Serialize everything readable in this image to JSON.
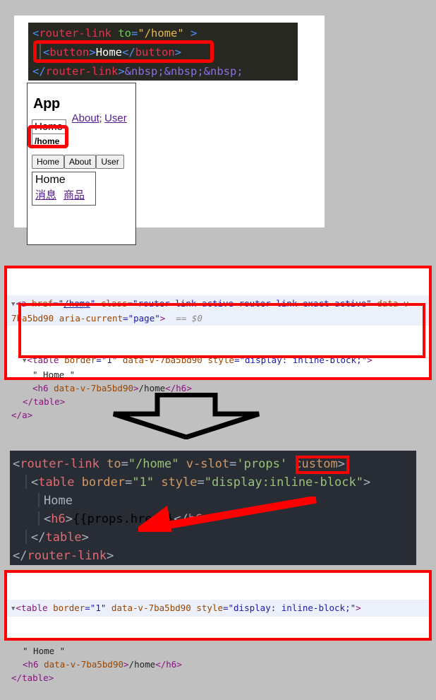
{
  "page": {
    "background_color": "#c0c0c0",
    "white_area_color": "#ffffff",
    "highlight_color": "#ff0000"
  },
  "code_top": {
    "theme_background": "#272822",
    "lines": [
      {
        "tokens": [
          {
            "t": "<",
            "c": "punct"
          },
          {
            "t": "router-link",
            "c": "tag"
          },
          {
            "t": " ",
            "c": "text"
          },
          {
            "t": "to",
            "c": "attr"
          },
          {
            "t": "=",
            "c": "punct"
          },
          {
            "t": "\"/home\"",
            "c": "val"
          },
          {
            "t": " ",
            "c": "text"
          },
          {
            "t": ">",
            "c": "punct"
          }
        ]
      },
      {
        "indent": true,
        "tokens": [
          {
            "t": "<",
            "c": "punct"
          },
          {
            "t": "button",
            "c": "tag"
          },
          {
            "t": ">",
            "c": "punct"
          },
          {
            "t": "Home",
            "c": "text"
          },
          {
            "t": "</",
            "c": "punct"
          },
          {
            "t": "button",
            "c": "tag"
          },
          {
            "t": ">",
            "c": "punct"
          }
        ]
      },
      {
        "tokens": [
          {
            "t": "</",
            "c": "punct"
          },
          {
            "t": "router-link",
            "c": "tag"
          },
          {
            "t": ">",
            "c": "punct"
          },
          {
            "t": "&nbsp;&nbsp;&nbsp;",
            "c": "entity"
          }
        ]
      }
    ],
    "highlighted_line": "<button>Home</button>"
  },
  "app_preview": {
    "title": "App",
    "home_cell_label": "Home",
    "home_path": "/home",
    "nav_links": [
      {
        "label": "About",
        "color": "#551a8b"
      },
      {
        "label": "User",
        "color": "#551a8b"
      }
    ],
    "nav_separator": ";",
    "buttons": [
      "Home",
      "About",
      "User"
    ],
    "content_title": "Home",
    "content_links": [
      "消息",
      "商品"
    ]
  },
  "devtools_top": {
    "selected_line": {
      "triangle": "▼",
      "tokens": [
        {
          "t": "<",
          "c": "ang"
        },
        {
          "t": "a",
          "c": "name"
        },
        {
          "t": " ",
          "c": "txt"
        },
        {
          "t": "href",
          "c": "attr"
        },
        {
          "t": "=\"",
          "c": "aval"
        },
        {
          "t": "/home",
          "c": "link"
        },
        {
          "t": "\"",
          "c": "aval"
        },
        {
          "t": " ",
          "c": "txt"
        },
        {
          "t": "class",
          "c": "attr"
        },
        {
          "t": "=\"router-link-active router-link-exact-active\"",
          "c": "aval"
        },
        {
          "t": " ",
          "c": "txt"
        },
        {
          "t": "data-v-7ba5bd90",
          "c": "attr"
        },
        {
          "t": " ",
          "c": "txt"
        },
        {
          "t": "aria-current",
          "c": "attr"
        },
        {
          "t": "=\"page\"",
          "c": "aval"
        },
        {
          "t": ">",
          "c": "ang"
        },
        {
          "t": "  == $0",
          "c": "gray"
        }
      ]
    },
    "child_lines": [
      {
        "indent": 1,
        "triangle": "▼",
        "tokens": [
          {
            "t": "<",
            "c": "ang"
          },
          {
            "t": "table",
            "c": "name"
          },
          {
            "t": " ",
            "c": "txt"
          },
          {
            "t": "border",
            "c": "attr"
          },
          {
            "t": "=\"1\"",
            "c": "aval"
          },
          {
            "t": " ",
            "c": "txt"
          },
          {
            "t": "data-v-7ba5bd90",
            "c": "attr"
          },
          {
            "t": " ",
            "c": "txt"
          },
          {
            "t": "style",
            "c": "attr"
          },
          {
            "t": "=\"display: inline-block;\"",
            "c": "aval"
          },
          {
            "t": ">",
            "c": "ang"
          }
        ]
      },
      {
        "indent": 2,
        "tokens": [
          {
            "t": "\" Home \"",
            "c": "txt"
          }
        ]
      },
      {
        "indent": 2,
        "tokens": [
          {
            "t": "<",
            "c": "ang"
          },
          {
            "t": "h6",
            "c": "name"
          },
          {
            "t": " ",
            "c": "txt"
          },
          {
            "t": "data-v-7ba5bd90",
            "c": "attr"
          },
          {
            "t": ">",
            "c": "ang"
          },
          {
            "t": "/home",
            "c": "txt"
          },
          {
            "t": "</",
            "c": "ang"
          },
          {
            "t": "h6",
            "c": "name"
          },
          {
            "t": ">",
            "c": "ang"
          }
        ]
      },
      {
        "indent": 1,
        "tokens": [
          {
            "t": "</",
            "c": "ang"
          },
          {
            "t": "table",
            "c": "name"
          },
          {
            "t": ">",
            "c": "ang"
          }
        ]
      },
      {
        "indent": 0,
        "tokens": [
          {
            "t": "</",
            "c": "ang"
          },
          {
            "t": "a",
            "c": "name"
          },
          {
            "t": ">",
            "c": "ang"
          }
        ]
      }
    ]
  },
  "code_bottom": {
    "theme_background": "#282c34",
    "lines": [
      {
        "indent": 0,
        "tokens": [
          {
            "t": "<",
            "c": "punct"
          },
          {
            "t": "router-link",
            "c": "tag"
          },
          {
            "t": " ",
            "c": "text"
          },
          {
            "t": "to",
            "c": "attr"
          },
          {
            "t": "=",
            "c": "punct"
          },
          {
            "t": "\"/home\"",
            "c": "val"
          },
          {
            "t": " ",
            "c": "text"
          },
          {
            "t": "v-slot",
            "c": "attr"
          },
          {
            "t": "=",
            "c": "punct"
          },
          {
            "t": "'props'",
            "c": "val"
          },
          {
            "t": " ",
            "c": "text"
          },
          {
            "t": "custom",
            "c": "attr"
          },
          {
            "t": ">",
            "c": "punct"
          }
        ]
      },
      {
        "indent": 1,
        "tokens": [
          {
            "t": "<",
            "c": "punct"
          },
          {
            "t": "table",
            "c": "tag"
          },
          {
            "t": " ",
            "c": "text"
          },
          {
            "t": "border",
            "c": "attr"
          },
          {
            "t": "=",
            "c": "punct"
          },
          {
            "t": "\"1\"",
            "c": "val"
          },
          {
            "t": " ",
            "c": "text"
          },
          {
            "t": "style",
            "c": "attr"
          },
          {
            "t": "=",
            "c": "punct"
          },
          {
            "t": "\"display:inline-block\"",
            "c": "val"
          },
          {
            "t": ">",
            "c": "punct"
          }
        ]
      },
      {
        "indent": 2,
        "tokens": [
          {
            "t": "Home",
            "c": "text"
          }
        ]
      },
      {
        "indent": 2,
        "tokens": [
          {
            "t": "<",
            "c": "punct"
          },
          {
            "t": "h6",
            "c": "tag"
          },
          {
            "t": ">",
            "c": "punct"
          },
          {
            "t": "{{props.href}}",
            "c": "mustache"
          },
          {
            "t": "</",
            "c": "punct"
          },
          {
            "t": "h6",
            "c": "tag"
          },
          {
            "t": ">",
            "c": "punct"
          }
        ]
      },
      {
        "indent": 1,
        "tokens": [
          {
            "t": "</",
            "c": "punct"
          },
          {
            "t": "table",
            "c": "tag"
          },
          {
            "t": ">",
            "c": "punct"
          }
        ]
      },
      {
        "indent": 0,
        "tokens": [
          {
            "t": "</",
            "c": "punct"
          },
          {
            "t": "router-link",
            "c": "tag"
          },
          {
            "t": ">",
            "c": "punct"
          }
        ]
      }
    ],
    "highlighted_token": "custom"
  },
  "devtools_bottom": {
    "selected_line": {
      "triangle": "▼",
      "tokens": [
        {
          "t": "<",
          "c": "ang"
        },
        {
          "t": "table",
          "c": "name"
        },
        {
          "t": " ",
          "c": "txt"
        },
        {
          "t": "border",
          "c": "attr"
        },
        {
          "t": "=\"1\"",
          "c": "aval"
        },
        {
          "t": " ",
          "c": "txt"
        },
        {
          "t": "data-v-7ba5bd90",
          "c": "attr"
        },
        {
          "t": " ",
          "c": "txt"
        },
        {
          "t": "style",
          "c": "attr"
        },
        {
          "t": "=\"display: inline-block;\"",
          "c": "aval"
        },
        {
          "t": ">",
          "c": "ang"
        }
      ]
    },
    "child_lines": [
      {
        "indent": 1,
        "tokens": [
          {
            "t": "\" Home \"",
            "c": "txt"
          }
        ]
      },
      {
        "indent": 1,
        "tokens": [
          {
            "t": "<",
            "c": "ang"
          },
          {
            "t": "h6",
            "c": "name"
          },
          {
            "t": " ",
            "c": "txt"
          },
          {
            "t": "data-v-7ba5bd90",
            "c": "attr"
          },
          {
            "t": ">",
            "c": "ang"
          },
          {
            "t": "/home",
            "c": "txt"
          },
          {
            "t": "</",
            "c": "ang"
          },
          {
            "t": "h6",
            "c": "name"
          },
          {
            "t": ">",
            "c": "ang"
          }
        ]
      },
      {
        "indent": 0,
        "tokens": [
          {
            "t": "</",
            "c": "ang"
          },
          {
            "t": "table",
            "c": "name"
          },
          {
            "t": ">",
            "c": "ang"
          }
        ]
      }
    ]
  },
  "arrows": {
    "down_arrow_color": "#000000",
    "pointer_arrow_color": "#ff0000"
  }
}
